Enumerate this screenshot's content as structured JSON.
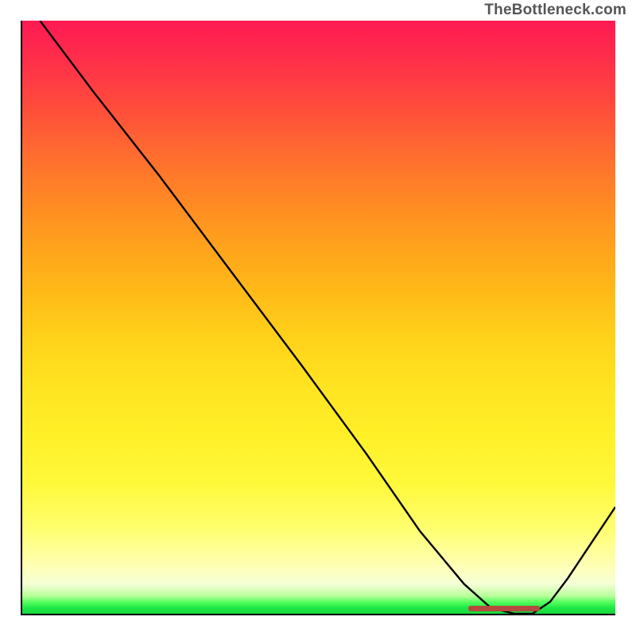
{
  "watermark": "TheBottleneck.com",
  "chart_data": {
    "type": "line",
    "title": "",
    "xlabel": "",
    "ylabel": "",
    "xlim": [
      0,
      100
    ],
    "ylim": [
      0,
      100
    ],
    "grid": false,
    "legend": false,
    "background": "heatmap-vertical",
    "background_stops": [
      {
        "pos": 0,
        "color": "#ff1a53"
      },
      {
        "pos": 22,
        "color": "#ff6a30"
      },
      {
        "pos": 46,
        "color": "#ffd31a"
      },
      {
        "pos": 70,
        "color": "#fff028"
      },
      {
        "pos": 92,
        "color": "#ffffb6"
      },
      {
        "pos": 100,
        "color": "#18d83e"
      }
    ],
    "series": [
      {
        "name": "bottleneck-curve",
        "color": "#000000",
        "x": [
          3,
          12,
          23,
          35,
          47,
          58,
          67,
          74.5,
          79,
          83,
          86,
          89,
          92,
          96,
          100
        ],
        "y": [
          100,
          88,
          74,
          58,
          42,
          27,
          14,
          5,
          1,
          0,
          0,
          2,
          6,
          12,
          18
        ]
      }
    ],
    "annotations": [
      {
        "name": "optimal-range-marker",
        "type": "bar",
        "color": "#b54a3e",
        "x_start": 75,
        "x_end": 87,
        "y": 0
      }
    ]
  }
}
